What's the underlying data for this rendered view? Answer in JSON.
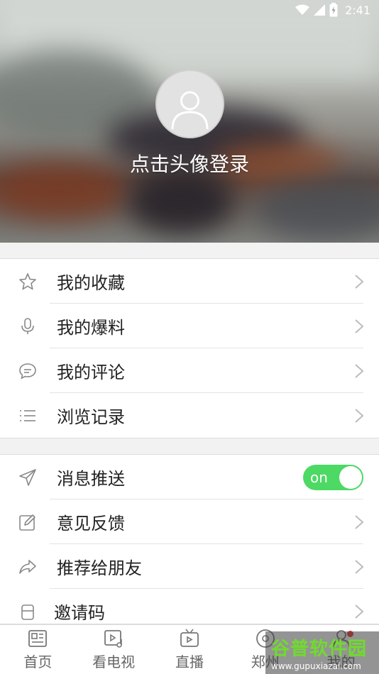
{
  "status_bar": {
    "time": "2:41"
  },
  "header": {
    "login_prompt": "点击头像登录"
  },
  "menu_group_1": [
    {
      "icon": "star-icon",
      "label": "我的收藏"
    },
    {
      "icon": "microphone-icon",
      "label": "我的爆料"
    },
    {
      "icon": "comment-icon",
      "label": "我的评论"
    },
    {
      "icon": "list-icon",
      "label": "浏览记录"
    }
  ],
  "menu_group_2": {
    "push": {
      "icon": "send-icon",
      "label": "消息推送",
      "toggle_text": "on",
      "toggle_state": true
    },
    "items": [
      {
        "icon": "edit-icon",
        "label": "意见反馈"
      },
      {
        "icon": "share-icon",
        "label": "推荐给朋友"
      },
      {
        "icon": "invite-code-icon",
        "label": "邀请码"
      }
    ]
  },
  "tabs": [
    {
      "icon": "news-icon",
      "label": "首页"
    },
    {
      "icon": "video-icon",
      "label": "看电视"
    },
    {
      "icon": "tv-icon",
      "label": "直播"
    },
    {
      "icon": "radio-icon",
      "label": "郑州"
    },
    {
      "icon": "profile-icon",
      "label": "我的"
    }
  ],
  "watermark": {
    "main": "谷普软件园",
    "sub": "www.gupuxiazai.com"
  },
  "colors": {
    "toggle_on": "#4cd964",
    "badge_dot": "#e53935"
  }
}
